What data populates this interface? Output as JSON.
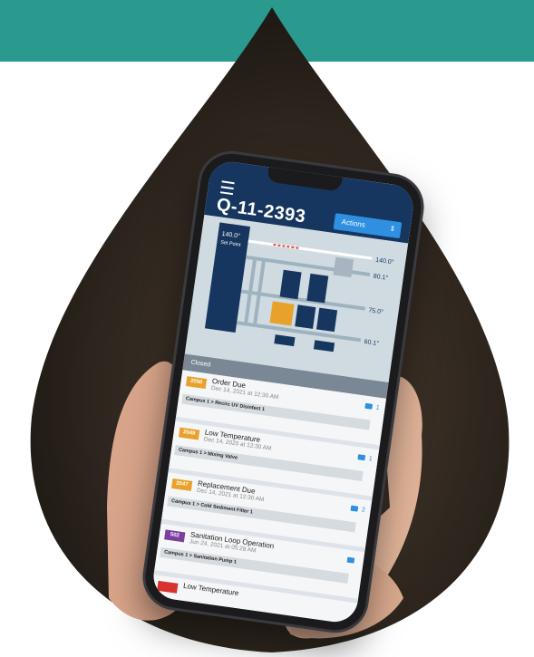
{
  "app": {
    "title": "Q-11-2393",
    "actions_label": "Actions"
  },
  "diagram": {
    "setpoint_value": "140.0°",
    "setpoint_label": "Set Point",
    "temps": [
      "140.0°",
      "80.1°",
      "75.0°",
      "60.1°"
    ]
  },
  "section_label": "Closed",
  "alerts": [
    {
      "id": "2050",
      "title": "Order Due",
      "date": "Dec 14, 2021 at 12:30 AM",
      "path": "Campus 1 > Recirc UV Disinfect 1",
      "comments": "1",
      "color": "#e8a12b"
    },
    {
      "id": "2049",
      "title": "Low Temperature",
      "date": "Dec 14, 2020 at 12:30 AM",
      "path": "Campus 1 > Mixing Valve",
      "comments": "1",
      "color": "#e8a12b"
    },
    {
      "id": "2047",
      "title": "Replacement Due",
      "date": "Dec 14, 2021 at 12:30 AM",
      "path": "Campus 1 > Cold Sediment Filter 1",
      "comments": "2",
      "color": "#e8a12b"
    },
    {
      "id": "502",
      "title": "Sanitation Loop Operation",
      "date": "Jun 24, 2021 at 05:28 AM",
      "path": "Campus 1 > Sanitation Pump 1",
      "comments": "",
      "color": "#7a3fa0"
    },
    {
      "id": "",
      "title": "Low Temperature",
      "date": "",
      "path": "",
      "comments": "",
      "color": "#d8322e"
    }
  ],
  "colors": {
    "teal": "#2a9a8f",
    "header": "#16365f",
    "accent": "#2f8fe0"
  }
}
